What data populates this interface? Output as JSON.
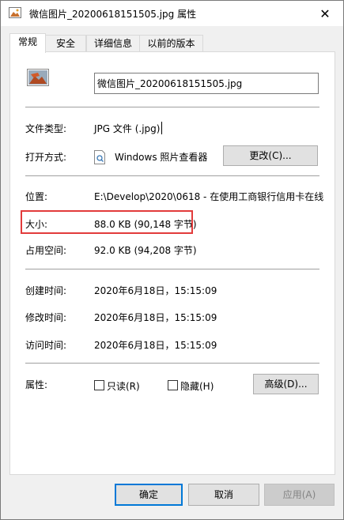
{
  "window": {
    "title": "微信图片_20200618151505.jpg 属性",
    "close_glyph": "✕"
  },
  "tabs": [
    {
      "label": "常规",
      "active": true
    },
    {
      "label": "安全",
      "active": false
    },
    {
      "label": "详细信息",
      "active": false
    },
    {
      "label": "以前的版本",
      "active": false
    }
  ],
  "general": {
    "file_name": "微信图片_20200618151505.jpg",
    "type_label": "文件类型:",
    "type_value": "JPG 文件 (.jpg)",
    "open_with_label": "打开方式:",
    "open_with_value": "Windows 照片查看器",
    "change_button": "更改(C)...",
    "location_label": "位置:",
    "location_value": "E:\\Develop\\2020\\0618 - 在使用工商银行信用卡在线",
    "size_label": "大小:",
    "size_value": "88.0 KB (90,148 字节)",
    "disk_size_label": "占用空间:",
    "disk_size_value": "92.0 KB (94,208 字节)",
    "created_label": "创建时间:",
    "created_value": "2020年6月18日，15:15:09",
    "modified_label": "修改时间:",
    "modified_value": "2020年6月18日，15:15:09",
    "accessed_label": "访问时间:",
    "accessed_value": "2020年6月18日，15:15:09",
    "attributes_label": "属性:",
    "readonly_label": "只读(R)",
    "readonly_checked": false,
    "hidden_label": "隐藏(H)",
    "hidden_checked": false,
    "advanced_button": "高级(D)..."
  },
  "footer": {
    "ok": "确定",
    "cancel": "取消",
    "apply": "应用(A)"
  },
  "colors": {
    "highlight_border": "#e23b3b",
    "primary_border": "#0078d7"
  }
}
